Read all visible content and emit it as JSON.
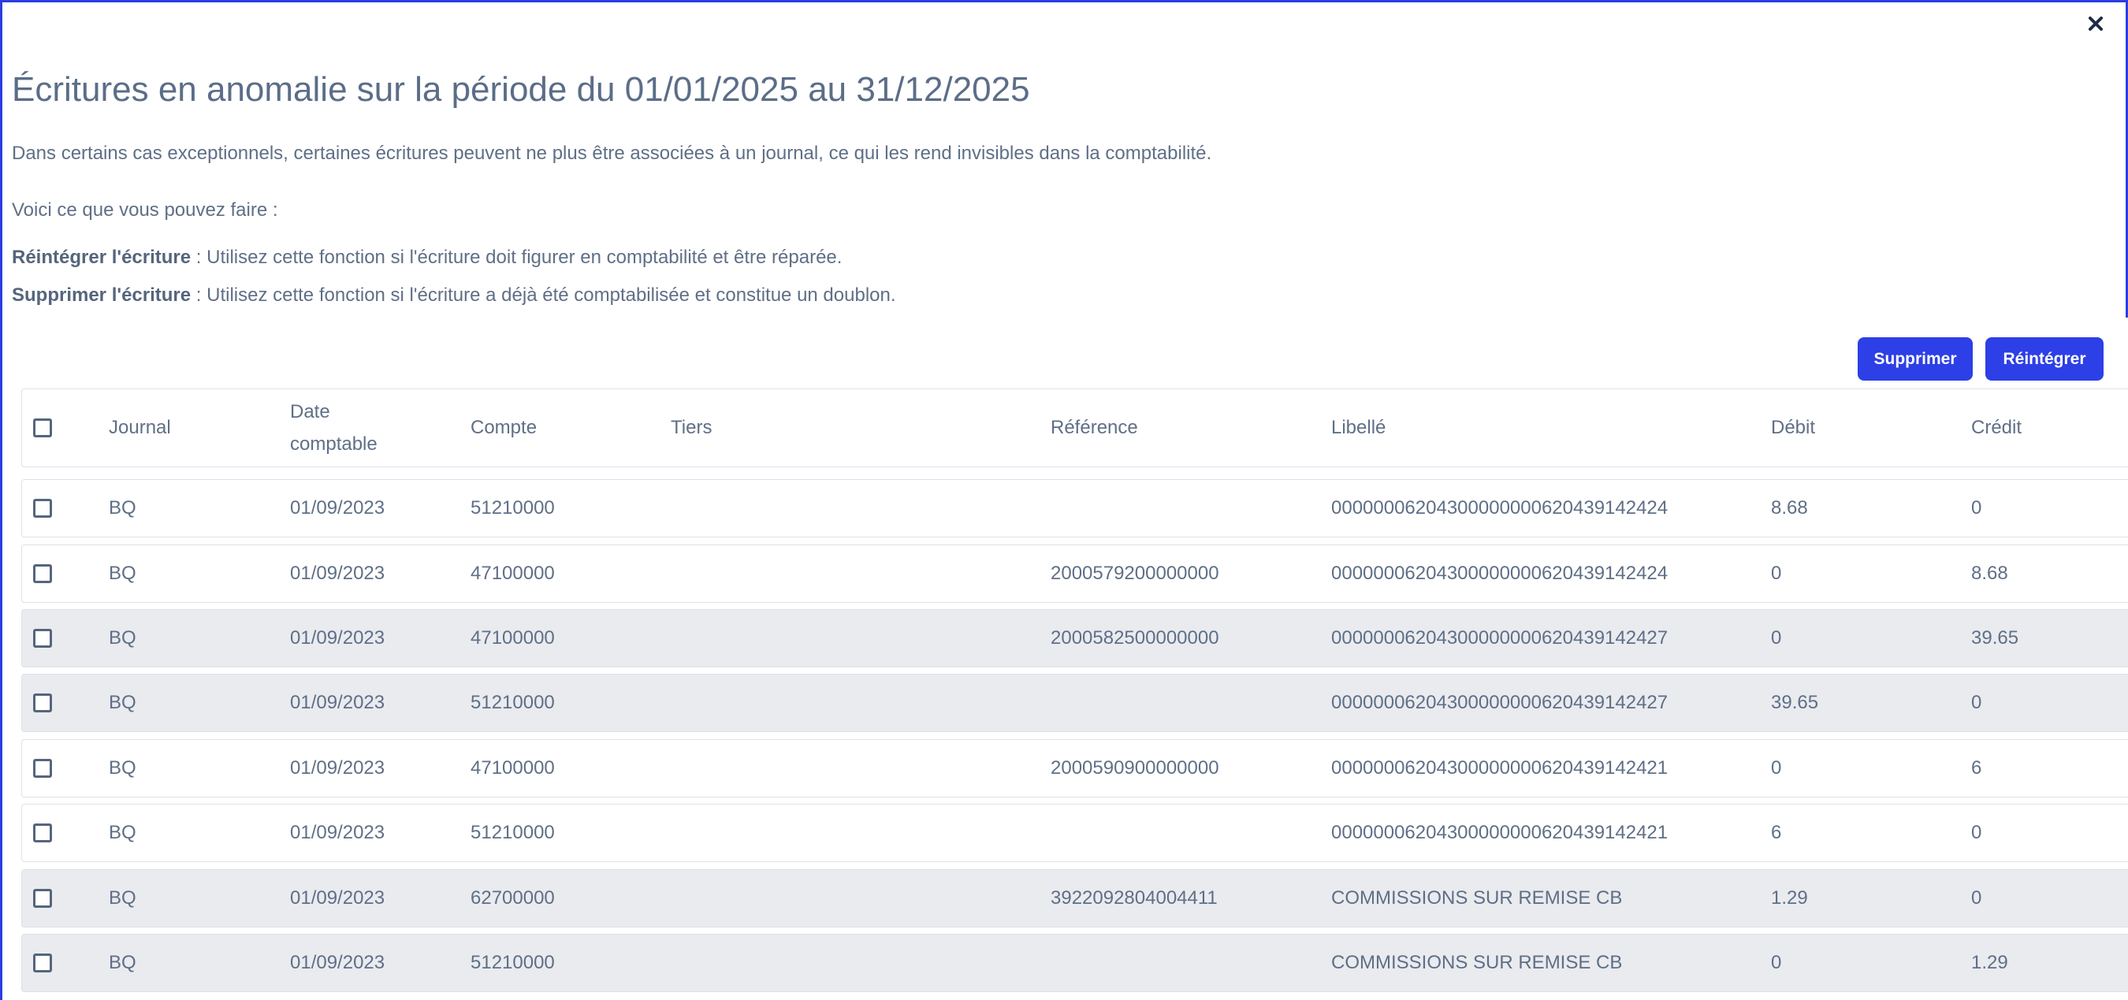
{
  "modal": {
    "title": "Écritures en anomalie sur la période du 01/01/2025 au 31/12/2025",
    "intro": "Dans certains cas exceptionnels, certaines écritures peuvent ne plus être associées à un journal, ce qui les rend invisibles dans la comptabilité.",
    "options_lead": "Voici ce que vous pouvez faire :",
    "reintegrate_term": "Réintégrer l'écriture",
    "reintegrate_desc": " : Utilisez cette fonction si l'écriture doit figurer en comptabilité et être réparée.",
    "delete_term": "Supprimer l'écriture",
    "delete_desc": " : Utilisez cette fonction si l'écriture a déjà été comptabilisée et constitue un doublon.",
    "close_icon": "close-icon"
  },
  "actions": {
    "delete_label": "Supprimer",
    "reintegrate_label": "Réintégrer",
    "accent_color": "#2d3fe6"
  },
  "table": {
    "headers": {
      "journal": "Journal",
      "date": "Date comptable",
      "compte": "Compte",
      "tiers": "Tiers",
      "reference": "Référence",
      "libelle": "Libellé",
      "debit": "Débit",
      "credit": "Crédit"
    },
    "rows": [
      {
        "journal": "BQ",
        "date": "01/09/2023",
        "compte": "51210000",
        "tiers": "",
        "reference": "",
        "libelle": "00000006204300000000620439142424",
        "debit": "8.68",
        "credit": "0",
        "shaded": false
      },
      {
        "journal": "BQ",
        "date": "01/09/2023",
        "compte": "47100000",
        "tiers": "",
        "reference": "2000579200000000",
        "libelle": "00000006204300000000620439142424",
        "debit": "0",
        "credit": "8.68",
        "shaded": false
      },
      {
        "journal": "BQ",
        "date": "01/09/2023",
        "compte": "47100000",
        "tiers": "",
        "reference": "2000582500000000",
        "libelle": "00000006204300000000620439142427",
        "debit": "0",
        "credit": "39.65",
        "shaded": true
      },
      {
        "journal": "BQ",
        "date": "01/09/2023",
        "compte": "51210000",
        "tiers": "",
        "reference": "",
        "libelle": "00000006204300000000620439142427",
        "debit": "39.65",
        "credit": "0",
        "shaded": true
      },
      {
        "journal": "BQ",
        "date": "01/09/2023",
        "compte": "47100000",
        "tiers": "",
        "reference": "2000590900000000",
        "libelle": "00000006204300000000620439142421",
        "debit": "0",
        "credit": "6",
        "shaded": false
      },
      {
        "journal": "BQ",
        "date": "01/09/2023",
        "compte": "51210000",
        "tiers": "",
        "reference": "",
        "libelle": "00000006204300000000620439142421",
        "debit": "6",
        "credit": "0",
        "shaded": false
      },
      {
        "journal": "BQ",
        "date": "01/09/2023",
        "compte": "62700000",
        "tiers": "",
        "reference": "3922092804004411",
        "libelle": "COMMISSIONS SUR REMISE CB",
        "debit": "1.29",
        "credit": "0",
        "shaded": true
      },
      {
        "journal": "BQ",
        "date": "01/09/2023",
        "compte": "51210000",
        "tiers": "",
        "reference": "",
        "libelle": "COMMISSIONS SUR REMISE CB",
        "debit": "0",
        "credit": "1.29",
        "shaded": true
      }
    ]
  }
}
